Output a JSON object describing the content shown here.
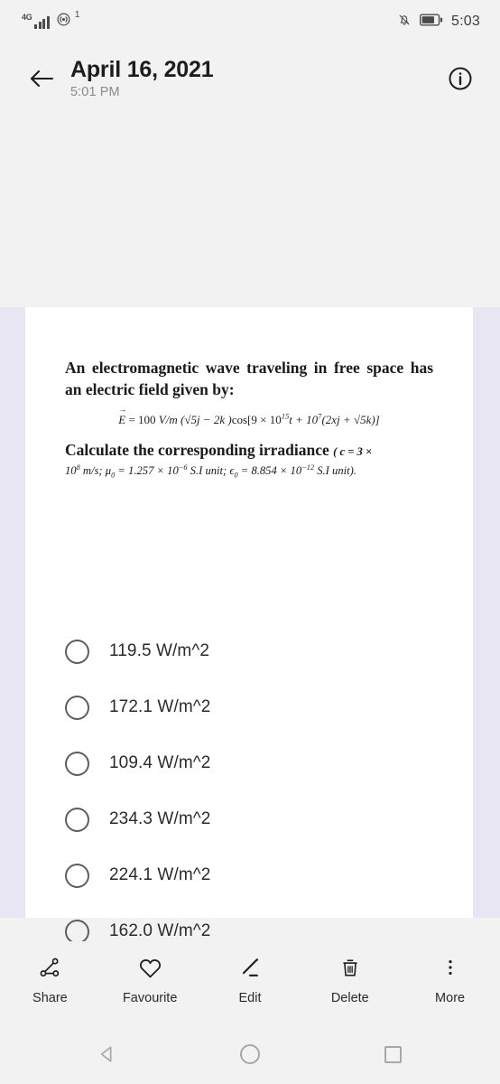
{
  "status_bar": {
    "network_type": "4G",
    "signal_icon": "signal-bars-icon",
    "hotspot_icon": "wifi-hotspot-icon",
    "sim_superscript": "1",
    "mute_icon": "bell-muted-icon",
    "battery_icon": "battery-icon",
    "battery_level_percent": 70,
    "time": "5:03"
  },
  "app_bar": {
    "back_icon": "back-arrow-icon",
    "title": "April 16, 2021",
    "subtitle": "5:01 PM",
    "info_icon": "info-circle-icon"
  },
  "document": {
    "question_line_1": "An electromagnetic wave traveling in free space",
    "question_line_2": "has an electric field given by:",
    "equation_plain": "E⃗ = 100 V/m (√5ĵ − 2k̂ ) cos[9 × 10¹⁵t + 10⁷(2xĵ + √5k̂)]",
    "equation_parts": {
      "lhs": "E",
      "eq": "=",
      "amplitude": "100",
      "units": "V/m",
      "vector_term": "(√5j − 2k )",
      "cos": "cos",
      "bracket_open": "[9 × 10",
      "omega_exp": "15",
      "t": "t + 10",
      "k_exp": "7",
      "phase": "(2xj + √5k)]"
    },
    "calculate_text": "Calculate the corresponding irradiance",
    "constants_open": "( c = 3 ×",
    "constants_line": "10⁸ m/s ; μ₀ = 1.257 × 10⁻⁶ S.I unit; ε₀ = 8.854 × 10⁻¹² S.I unit).",
    "constants_parts": {
      "c_value": "10",
      "c_exp": "8",
      "c_units": "m/s",
      "mu_label": "μ",
      "mu_sub": "0",
      "mu_value": "1.257 × 10",
      "mu_exp": "−6",
      "mu_units": "S.I unit;",
      "eps_label": "ϵ",
      "eps_sub": "0",
      "eps_value": "8.854 × 10",
      "eps_exp": "−12",
      "eps_units": "S.I unit)."
    },
    "options": [
      {
        "label": "119.5 W/m^2",
        "selected": false
      },
      {
        "label": "172.1 W/m^2",
        "selected": false
      },
      {
        "label": "109.4 W/m^2",
        "selected": false
      },
      {
        "label": "234.3 W/m^2",
        "selected": false
      },
      {
        "label": "224.1 W/m^2",
        "selected": false
      },
      {
        "label": "162.0 W/m^2",
        "selected": false
      }
    ],
    "warning_badge": {
      "icon": "exclamation-icon",
      "glyph": "!"
    },
    "page_background": "#e8e6f2",
    "card_background": "#ffffff"
  },
  "toolbar": {
    "items": [
      {
        "label": "Share",
        "icon": "share-nodes-icon"
      },
      {
        "label": "Favourite",
        "icon": "heart-icon"
      },
      {
        "label": "Edit",
        "icon": "pencil-icon"
      },
      {
        "label": "Delete",
        "icon": "trash-icon"
      },
      {
        "label": "More",
        "icon": "three-dots-vertical-icon"
      }
    ]
  },
  "nav_bar": {
    "back": "nav-back-triangle-icon",
    "home": "nav-home-circle-icon",
    "recents": "nav-recents-square-icon"
  },
  "colors": {
    "page_bg": "#f2f2f2",
    "card": "#ffffff",
    "paper_margin": "#e8e6f2",
    "text_primary": "#1d1d1d",
    "text_secondary": "#8b8b8b",
    "badge": "#6b6b71"
  }
}
